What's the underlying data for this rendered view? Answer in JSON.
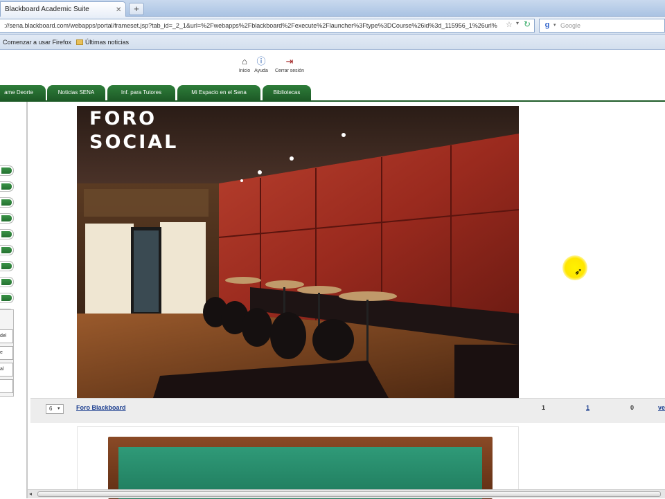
{
  "browser": {
    "tab_title": "Blackboard Academic Suite",
    "newtab_label": "+",
    "url": "://sena.blackboard.com/webapps/portal/frameset.jsp?tab_id=_2_1&url=%2Fwebapps%2Fblackboard%2Fexecute%2Flauncher%3Ftype%3DCourse%26id%3d_115956_1%26url%",
    "search_placeholder": "Google",
    "bookmarks": [
      "Comenzar a usar Firefox",
      "Últimas noticias"
    ]
  },
  "toplinks": [
    {
      "label": "Inicio",
      "icon": "home-icon"
    },
    {
      "label": "Ayuda",
      "icon": "help-icon"
    },
    {
      "label": "Cerrar sesión",
      "icon": "logout-icon"
    }
  ],
  "navtabs": [
    "ame Deorte",
    "Noticias SENA",
    "Inf. para Tutores",
    "Mi Espacio en el Sena",
    "Bibliotecas"
  ],
  "hero": {
    "title_line1": "FORO",
    "title_line2": "SOCIAL"
  },
  "forum_row": {
    "select_value": "6",
    "link": "Foro Blackboard",
    "counts": [
      "1",
      "1",
      "0"
    ],
    "trailing": "ve"
  },
  "leftpanel": [
    "del",
    "e",
    "al"
  ],
  "colors": {
    "nav_green": "#1d5a26",
    "link_blue": "#1a3d8f",
    "cursor_highlight": "#ffe600"
  }
}
